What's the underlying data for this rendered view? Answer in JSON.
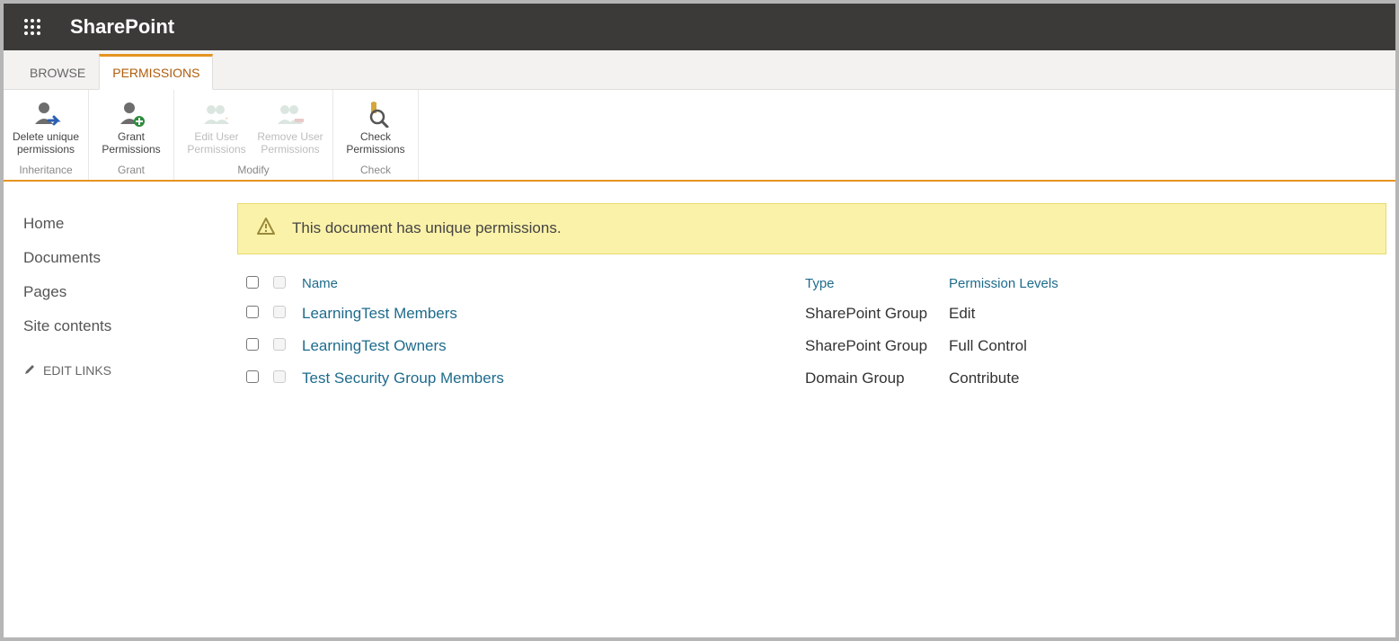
{
  "suitebar": {
    "brand": "SharePoint"
  },
  "tabs": {
    "browse": "BROWSE",
    "permissions": "PERMISSIONS"
  },
  "ribbon": {
    "delete_unique": "Delete unique\npermissions",
    "grant": "Grant\nPermissions",
    "edit_user": "Edit User\nPermissions",
    "remove_user": "Remove User\nPermissions",
    "check": "Check\nPermissions",
    "group_inheritance": "Inheritance",
    "group_grant": "Grant",
    "group_modify": "Modify",
    "group_check": "Check"
  },
  "leftnav": {
    "items": [
      "Home",
      "Documents",
      "Pages",
      "Site contents"
    ],
    "edit_links": "EDIT LINKS"
  },
  "notice": "This document has unique permissions.",
  "table": {
    "headers": {
      "name": "Name",
      "type": "Type",
      "level": "Permission Levels"
    },
    "rows": [
      {
        "name": "LearningTest Members",
        "type": "SharePoint Group",
        "level": "Edit"
      },
      {
        "name": "LearningTest Owners",
        "type": "SharePoint Group",
        "level": "Full Control"
      },
      {
        "name": "Test Security Group Members",
        "type": "Domain Group",
        "level": "Contribute"
      }
    ]
  }
}
